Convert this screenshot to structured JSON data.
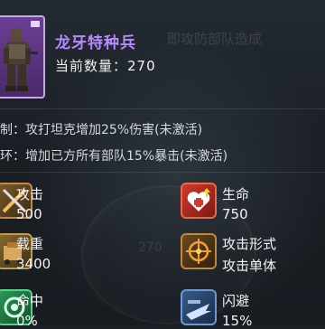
{
  "unit": {
    "name": "龙牙特种兵",
    "count_text": "当前数量：270"
  },
  "skills": [
    "制：攻打坦克增加25%伤害(未激活)",
    "环：增加已方所有部队15%暴击(未激活)"
  ],
  "stats": {
    "attack": {
      "label": "攻击",
      "value": "500",
      "icon": "crossed-blades-icon"
    },
    "hp": {
      "label": "生命",
      "value": "750",
      "icon": "heart-plus-icon"
    },
    "load": {
      "label": "载重",
      "value": "3400",
      "icon": "cargo-icon"
    },
    "attack_mode": {
      "label": "攻击形式",
      "value": "攻击单体",
      "icon": "crosshair-icon"
    },
    "hit": {
      "label": "命中",
      "value": "0%",
      "icon": "target-icon"
    },
    "dodge": {
      "label": "闪避",
      "value": "15%",
      "icon": "dodge-icon"
    }
  },
  "background": {
    "faded_top_text": "即攻防部队造成",
    "emblem_number": "270"
  },
  "colors": {
    "title": "#b889ff",
    "portrait_frame": "#6b3e93"
  }
}
